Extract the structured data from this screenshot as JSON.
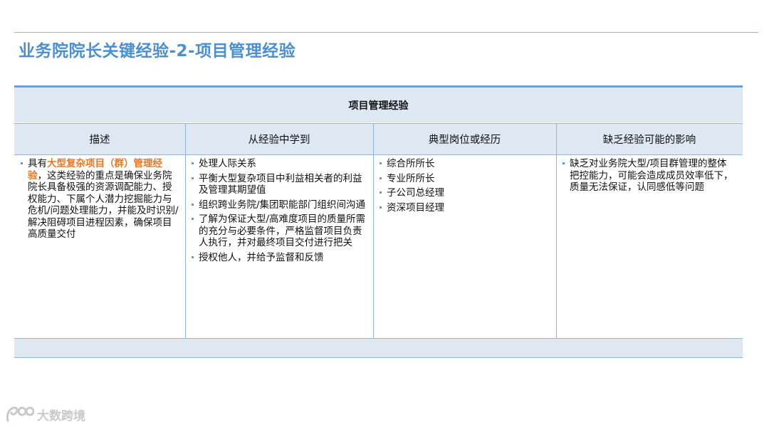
{
  "title": "业务院院长关键经验-2-项目管理经验",
  "table": {
    "caption": "项目管理经验",
    "headers": [
      "描述",
      "从经验中学到",
      "典型岗位或经历",
      "缺乏经验可能的影响"
    ],
    "description": {
      "prefix": "具有",
      "highlight": "大型复杂项目（群）管理经验",
      "rest": "，这类经验的重点是确保业务院院长具备极强的资源调配能力、授权能力、下属个人潜力挖掘能力与危机/问题处理能力，并能及时识别/解决阻碍项目进程因素，确保项目高质量交付"
    },
    "learned": [
      "处理人际关系",
      "平衡大型复杂项目中利益相关者的利益及管理其期望值",
      "组织跨业务院/集团职能部门组织间沟通",
      "了解为保证大型/高难度项目的质量所需的充分与必要条件，严格监督项目负责人执行，并对最终项目交付进行把关",
      "授权他人，并给予监督和反馈"
    ],
    "positions": [
      "综合所所长",
      "专业所所长",
      "子公司总经理",
      "资深项目经理"
    ],
    "impact": [
      "缺乏对业务院大型/项目群管理的整体把控能力，可能会造成成员效率低下，质量无法保证，认同感低等问题"
    ]
  },
  "watermark": {
    "text": "大数跨境",
    "icon": "logo-icon"
  },
  "colors": {
    "title": "#4a8fd1",
    "accent_line": "#6a9fd3",
    "header_fill": "#dde8f3",
    "highlight": "#e87722",
    "bullet": "#5b9bd5"
  }
}
